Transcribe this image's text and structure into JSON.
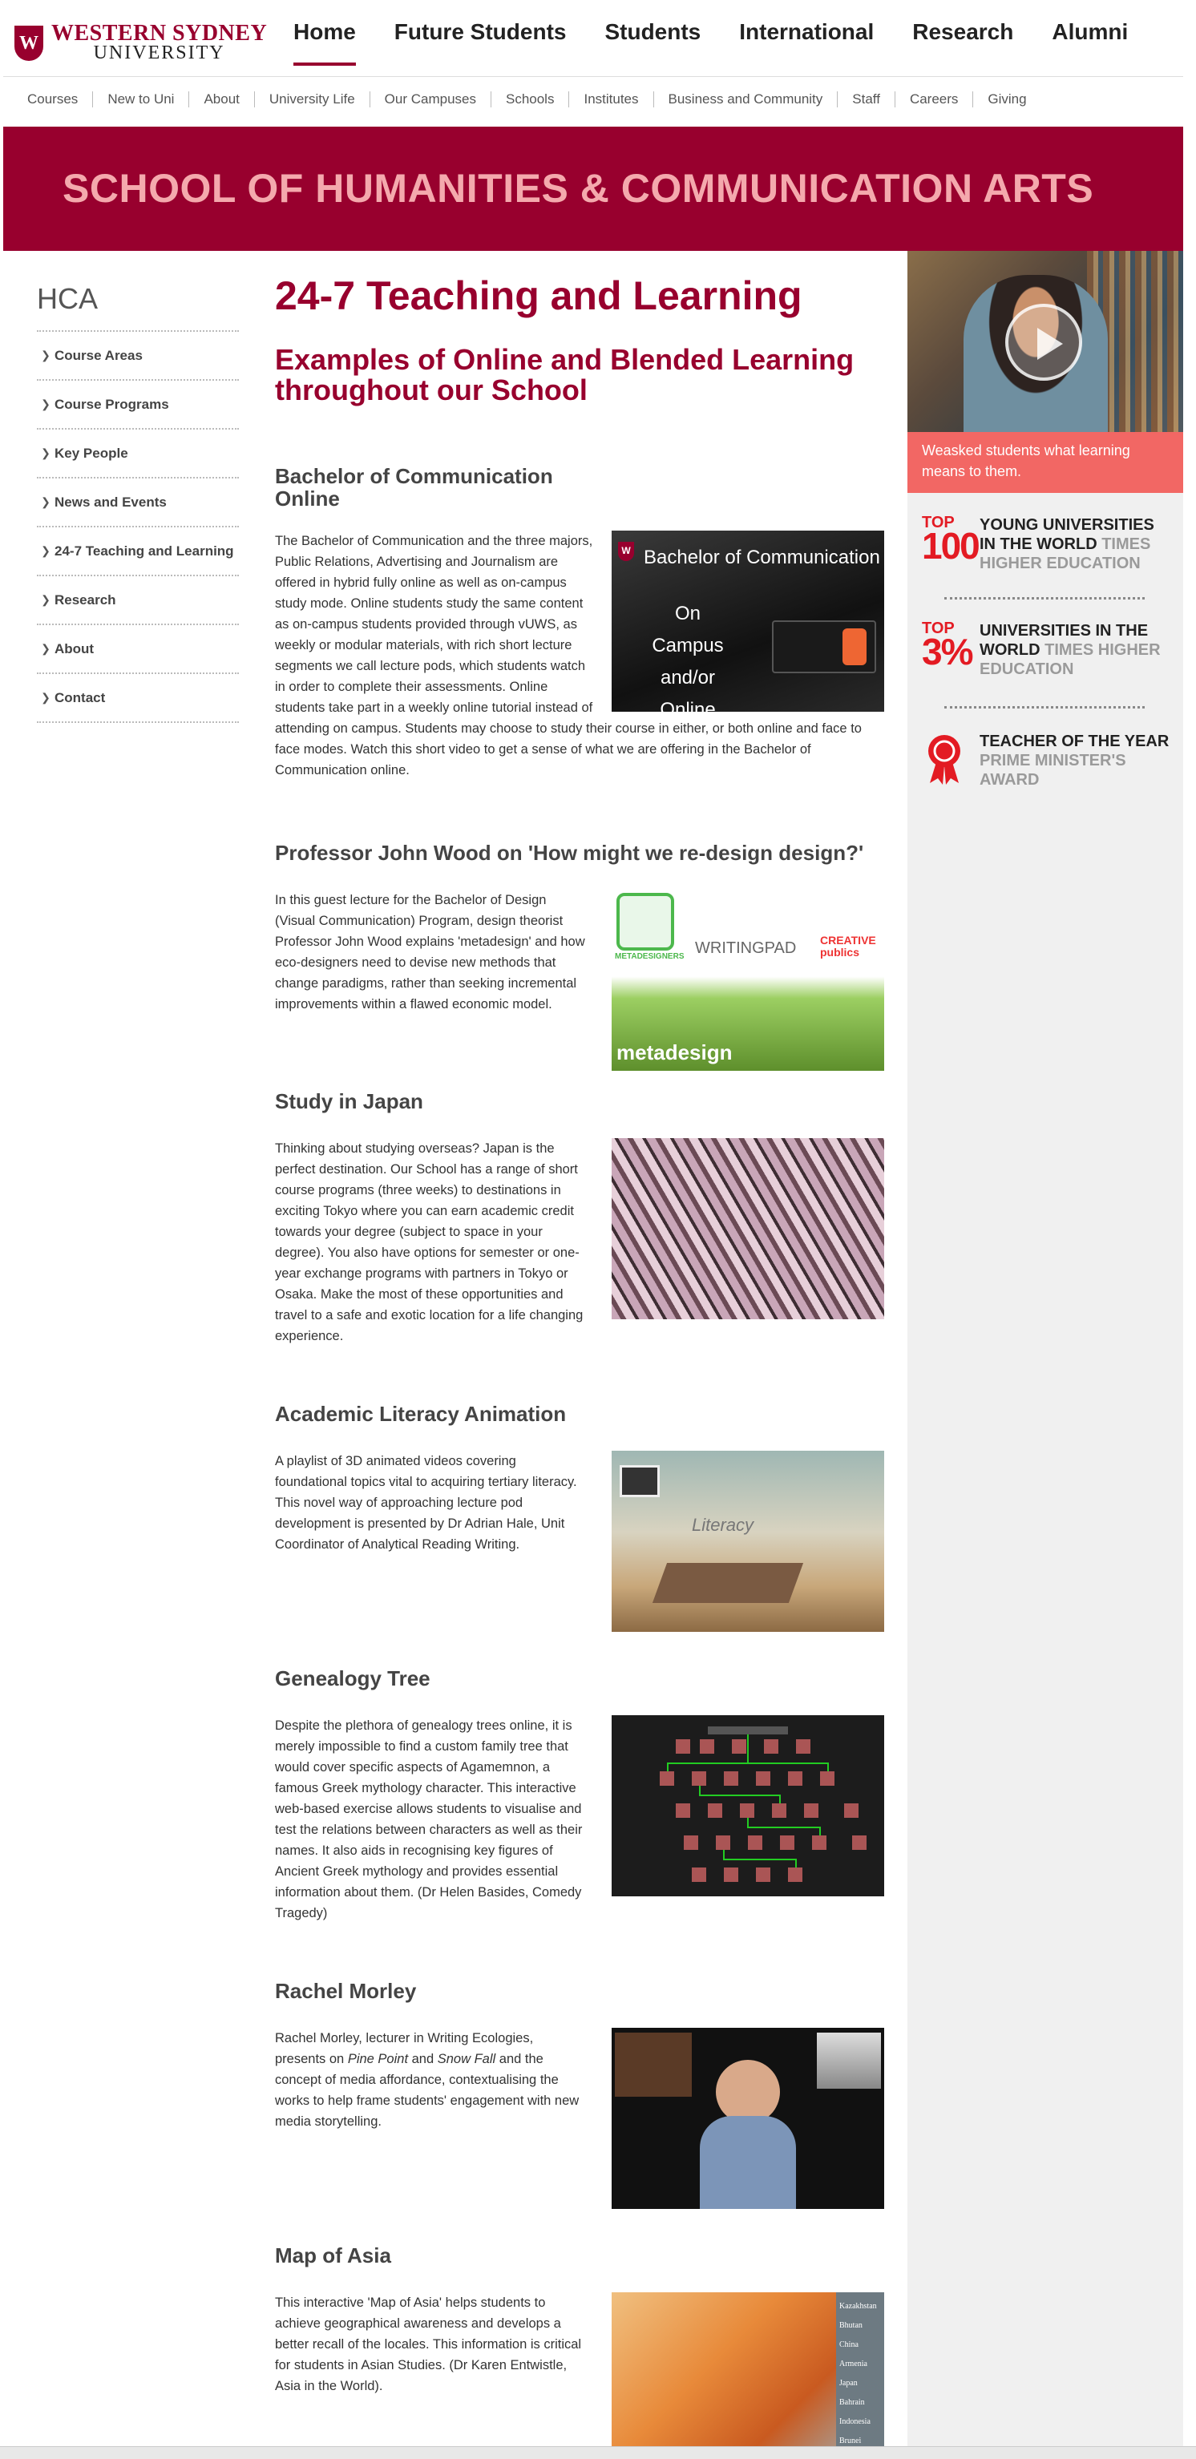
{
  "header": {
    "logo_mark": "W",
    "logo_line1": "WESTERN SYDNEY",
    "logo_line2": "UNIVERSITY",
    "nav": [
      "Home",
      "Future Students",
      "Students",
      "International",
      "Research",
      "Alumni"
    ],
    "subnav": [
      "Courses",
      "New to Uni",
      "About",
      "University Life",
      "Our Campuses",
      "Schools",
      "Institutes",
      "Business and Community",
      "Staff",
      "Careers",
      "Giving"
    ]
  },
  "banner": {
    "title": "SCHOOL OF HUMANITIES & COMMUNICATION ARTS"
  },
  "sidebar": {
    "title": "HCA",
    "items": [
      "Course Areas",
      "Course Programs",
      "Key People",
      "News and Events",
      "24-7 Teaching and Learning",
      "Research",
      "About",
      "Contact"
    ]
  },
  "main": {
    "title": "24-7 Teaching and Learning",
    "subtitle": "Examples of Online and Blended Learning throughout our School",
    "sections": [
      {
        "heading": "Bachelor of Communication Online",
        "body": "The Bachelor of Communication and the three majors, Public Relations, Advertising and Journalism are offered in hybrid fully online as well as on-campus study mode. Online students study the same content as on-campus students provided through vUWS, as weekly or modular materials, with rich short lecture segments we call lecture pods, which students watch in order to complete their assessments. Online students take part in a weekly online tutorial instead of attending on campus. Students may choose to study their course in either, or both online and face to face modes. Watch this short video to get a sense of what we are offering in the Bachelor of Communication online.",
        "thumb_title": "Bachelor of Communication",
        "thumb_lines": [
          "On Campus",
          "and/or",
          "Online"
        ]
      },
      {
        "heading": "Professor John Wood on 'How might we re-design design?'",
        "body": "In this guest lecture for the Bachelor of Design (Visual Communication) Program, design theorist Professor John Wood explains 'metadesign' and how eco-designers need to devise new methods that change paradigms, rather than seeking incremental improvements within a flawed economic model.",
        "thumb_labels": [
          "METADESIGNERS",
          "WRITINGPAD",
          "CREATIVE publics",
          "metadesign"
        ]
      },
      {
        "heading": "Study in Japan",
        "body": "Thinking about studying overseas? Japan is the perfect destination. Our School has a range of short course programs (three weeks) to destinations in exciting Tokyo where you can earn academic credit towards your degree (subject to space in your degree). You also have options for semester or one-year exchange programs with partners in Tokyo or Osaka. Make the most of these opportunities and travel to a safe and exotic location for a life changing experience."
      },
      {
        "heading": "Academic Literacy Animation",
        "body": "A playlist of 3D animated videos covering foundational topics vital to acquiring tertiary literacy. This novel way of approaching lecture pod development is presented by Dr Adrian Hale, Unit Coordinator of Analytical Reading Writing.",
        "thumb_label": "Literacy"
      },
      {
        "heading": "Genealogy Tree",
        "body": "Despite the plethora of genealogy trees online, it is merely impossible to find a custom family tree that would cover specific aspects of Agamemnon, a famous Greek mythology character. This interactive web-based exercise allows students to visualise and test the relations between characters as well as their names. It also aids in recognising key figures of Ancient Greek mythology and provides essential information about them. (Dr Helen Basides, Comedy Tragedy)"
      },
      {
        "heading": "Rachel Morley",
        "body_pre": "Rachel Morley, lecturer in Writing Ecologies, presents on ",
        "body_em1": "Pine Point",
        "body_mid": " and ",
        "body_em2": "Snow Fall",
        "body_post": " and the concept of media affordance, contextualising the works to help frame students' engagement with new media storytelling."
      },
      {
        "heading": "Map of Asia",
        "body": "This interactive 'Map of Asia' helps students to achieve geographical awareness and develops a better recall of the locales. This information is critical for students in Asian Studies. (Dr Karen Entwistle, Asia in the World).",
        "thumb_labels": [
          "Kazakhstan",
          "Bhutan",
          "China",
          "Armenia",
          "Japan",
          "Bahrain",
          "Indonesia",
          "Brunei"
        ]
      }
    ]
  },
  "rightcol": {
    "video_caption": "Weasked students what learning means to them.",
    "awards": [
      {
        "top": "TOP",
        "big": "100",
        "title": "YOUNG UNIVERSITIES IN THE WORLD",
        "grey": "TIMES HIGHER EDUCATION"
      },
      {
        "top": "TOP",
        "big": "3%",
        "title": "UNIVERSITIES IN THE WORLD",
        "grey": "TIMES HIGHER EDUCATION"
      },
      {
        "title": "TEACHER OF THE YEAR",
        "grey": "PRIME MINISTER'S AWARD"
      }
    ]
  },
  "colors": {
    "brand": "#98002e",
    "banner_text": "#f4a9ad",
    "caption_bg": "#f26764",
    "award_red": "#e31b23"
  }
}
